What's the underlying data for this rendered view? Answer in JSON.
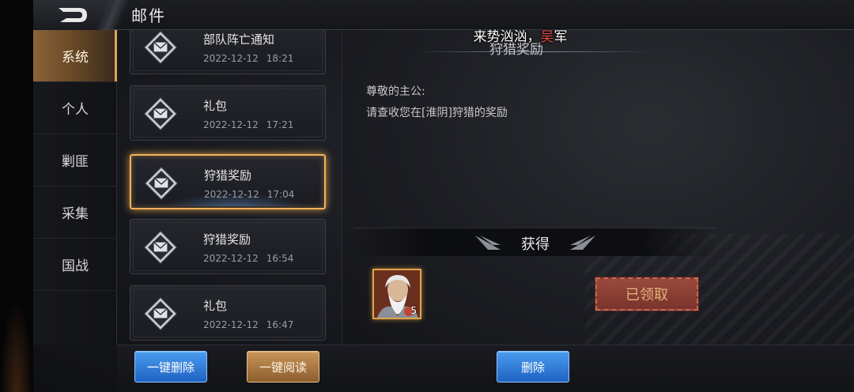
{
  "header": {
    "title": "邮件"
  },
  "sidebar": {
    "tabs": [
      {
        "label": "系统",
        "active": true
      },
      {
        "label": "个人",
        "active": false
      },
      {
        "label": "剿匪",
        "active": false
      },
      {
        "label": "采集",
        "active": false
      },
      {
        "label": "国战",
        "active": false
      }
    ]
  },
  "mail_list": [
    {
      "title": "部队阵亡通知",
      "date": "2022-12-12",
      "time": "18:21",
      "selected": false
    },
    {
      "title": "礼包",
      "date": "2022-12-12",
      "time": "17:21",
      "selected": false
    },
    {
      "title": "狩猎奖励",
      "date": "2022-12-12",
      "time": "17:04",
      "selected": true
    },
    {
      "title": "狩猎奖励",
      "date": "2022-12-12",
      "time": "16:54",
      "selected": false
    },
    {
      "title": "礼包",
      "date": "2022-12-12",
      "time": "16:47",
      "selected": false
    }
  ],
  "detail": {
    "banner_prefix": "来势汹汹，",
    "banner_red": "吴",
    "banner_suffix": "军",
    "title": "狩猎奖励",
    "greeting": "尊敬的主公:",
    "body": "请查收您在[淮阴]狩猎的奖励",
    "obtain_label": "获得",
    "reward": {
      "icon": "general-portrait-icon",
      "count": "5"
    },
    "claimed_label": "已领取"
  },
  "footer": {
    "delete_all": "一键删除",
    "read_all": "一键阅读",
    "delete": "删除"
  },
  "colors": {
    "accent_gold": "#f1b25d",
    "active_tab": "#8b6437",
    "claimed_red": "#8a3d33",
    "button_blue": "#2f7ad8",
    "banner_red": "#e24a3c"
  }
}
